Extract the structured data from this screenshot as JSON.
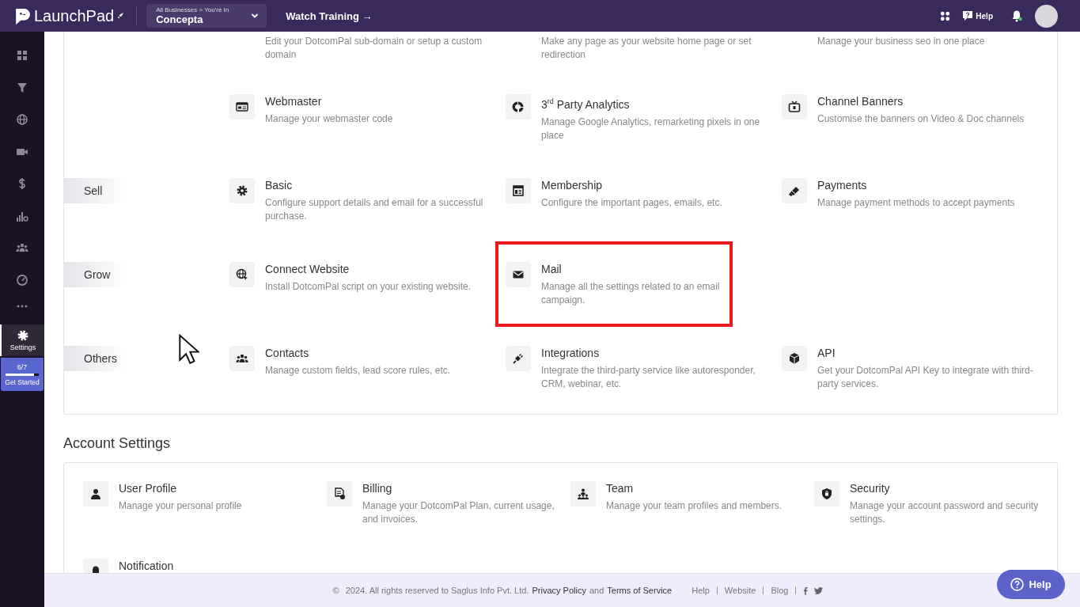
{
  "header": {
    "logo": "LaunchPad",
    "business_caption": "All Businesses > You're In",
    "business_name": "Concepta",
    "watch_training": "Watch Training →",
    "help": "Help"
  },
  "sidebar": {
    "items": [
      {
        "selected": false
      },
      {
        "selected": false
      },
      {
        "selected": false
      },
      {
        "selected": false
      },
      {
        "selected": false
      },
      {
        "selected": false
      },
      {
        "selected": false
      },
      {
        "selected": false
      },
      {
        "selected": false
      },
      {
        "label": "Settings",
        "selected": true
      }
    ],
    "progress": {
      "count": "6/7",
      "level": 0.85,
      "label": "Get Started"
    }
  },
  "business_settings": {
    "sections": [
      {
        "items": [
          {
            "description": "Edit your DotcomPal sub-domain or setup a custom domain",
            "highlighted": false
          },
          {
            "description": "Make any page as your website home page or set redirection",
            "highlighted": false
          },
          {
            "description": "Manage your business seo in one place",
            "highlighted": false
          },
          {
            "title": "Webmaster",
            "description": "Manage your webmaster code",
            "highlighted": false
          },
          {
            "title": "3$^{rd}$ Party Analytics",
            "description": "Manage Google Analytics, remarketing pixels in one place",
            "highlighted": false
          },
          {
            "title": "Channel Banners",
            "description": "Customise the banners on Video & Doc channels",
            "highlighted": false
          }
        ]
      },
      {
        "label": "Sell",
        "items": [
          {
            "title": "Basic",
            "description": "Configure support details and email for a successful purchase.",
            "highlighted": false
          },
          {
            "title": "Membership",
            "description": "Configure the important pages, emails, etc.",
            "highlighted": false
          },
          {
            "title": "Payments",
            "description": "Manage payment methods to accept payments",
            "highlighted": false
          }
        ]
      },
      {
        "label": "Grow",
        "items": [
          {
            "title": "Connect Website",
            "description": "Install DotcomPal script on your existing website.",
            "highlighted": false
          },
          {
            "title": "Mail",
            "description": "Manage all the settings related to an email campaign.",
            "highlighted": true
          }
        ]
      },
      {
        "label": "Others",
        "items": [
          {
            "title": "Contacts",
            "description": "Manage custom fields, lead score rules, etc.",
            "highlighted": false
          },
          {
            "title": "Integrations",
            "description": "Integrate the third-party service like autoresponder, CRM, webinar, etc.",
            "highlighted": false
          },
          {
            "title": "API",
            "description": "Get your DotcomPal API Key to integrate with third-party services.",
            "highlighted": false
          }
        ]
      }
    ]
  },
  "account_settings": {
    "heading": "Account Settings",
    "items": [
      {
        "title": "User Profile",
        "description": "Manage your personal profile"
      },
      {
        "title": "Billing",
        "description": "Manage your DotcomPal Plan, current usage, and invoices."
      },
      {
        "title": "Team",
        "description": "Manage your team profiles and members."
      },
      {
        "title": "Security",
        "description": "Manage your account password and security settings."
      },
      {
        "title": "Notification"
      }
    ]
  },
  "footer": {
    "copyright_symbol": "©",
    "copyright": "2024. All rights reserved to Saglus Info Pvt. Ltd.",
    "privacy_link": "Privacy Policy",
    "conjunction": "and",
    "terms_link": "Terms of Service",
    "links": [
      "Help",
      "Website",
      "Blog"
    ]
  },
  "help_button": {
    "label": "Help"
  }
}
